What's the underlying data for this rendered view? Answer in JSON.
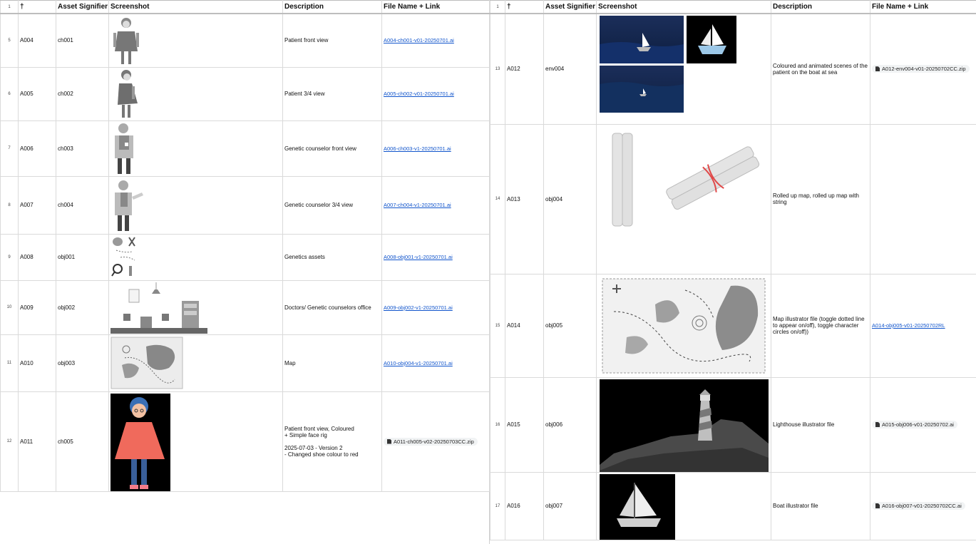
{
  "headers": {
    "row_num": "1",
    "dagger": "†",
    "asset": "Asset Signifier",
    "screenshot": "Screenshot",
    "description": "Description",
    "file": "File Name + Link"
  },
  "left_rows": [
    {
      "num": "5",
      "id": "A004",
      "sig": "ch001",
      "desc": "Patient front view",
      "file": "A004-ch001-v01-20250701.ai",
      "file_type": "link"
    },
    {
      "num": "6",
      "id": "A005",
      "sig": "ch002",
      "desc": "Patient 3/4 view",
      "file": "A005-ch002-v01-20250701.ai",
      "file_type": "link"
    },
    {
      "num": "7",
      "id": "A006",
      "sig": "ch003",
      "desc": "Genetic counselor front view",
      "file": "A006-ch003-v1-20250701.ai",
      "file_type": "link"
    },
    {
      "num": "8",
      "id": "A007",
      "sig": "ch004",
      "desc": "Genetic counselor 3/4 view",
      "file": "A007-ch004-v1-20250701.ai",
      "file_type": "link"
    },
    {
      "num": "9",
      "id": "A008",
      "sig": "obj001",
      "desc": "Genetics assets",
      "file": "A008-obj001-v1-20250701.ai",
      "file_type": "link"
    },
    {
      "num": "10",
      "id": "A009",
      "sig": "obj002",
      "desc": "Doctors/ Genetic counselors office",
      "file": "A009-obj002-v1-20250701.ai",
      "file_type": "link"
    },
    {
      "num": "11",
      "id": "A010",
      "sig": "obj003",
      "desc": "Map",
      "file": "A010-obj004-v1-20250701.ai",
      "file_type": "link"
    },
    {
      "num": "12",
      "id": "A011",
      "sig": "ch005",
      "desc": "Patient front view, Coloured\n+ Simple face rig\n\n2025-07-03 - Version 2\n- Changed shoe colour to red",
      "file": "A011-ch005-v02-20250703CC.zip",
      "file_type": "chip"
    }
  ],
  "right_rows": [
    {
      "num": "13",
      "id": "A012",
      "sig": "env004",
      "desc": "Coloured and animated scenes of the patient on the boat at sea",
      "file": "A012-env004-v01-20250702CC.zip",
      "file_type": "chip"
    },
    {
      "num": "14",
      "id": "A013",
      "sig": "obj004",
      "desc": "Rolled up map, rolled up map with string",
      "file": "",
      "file_type": "none"
    },
    {
      "num": "15",
      "id": "A014",
      "sig": "obj005",
      "desc": "Map illustrator file (toggle dotted line to appear on/off), toggle character circles on/off))",
      "file": "A014-obj005-v01-20250702RL",
      "file_type": "link"
    },
    {
      "num": "16",
      "id": "A015",
      "sig": "obj006",
      "desc": "Lighthouse illustrator file",
      "file": "A015-obj006-v01-20250702.ai",
      "file_type": "chip"
    },
    {
      "num": "17",
      "id": "A016",
      "sig": "obj007",
      "desc": "Boat illustrator file",
      "file": "A016-obj007-v01-20250702CC.ai",
      "file_type": "chip"
    }
  ],
  "colors": {
    "link": "#1155cc",
    "chip_bg": "#f1f3f4",
    "sea_dark": "#10244a",
    "coat_coral": "#f06a5c"
  }
}
